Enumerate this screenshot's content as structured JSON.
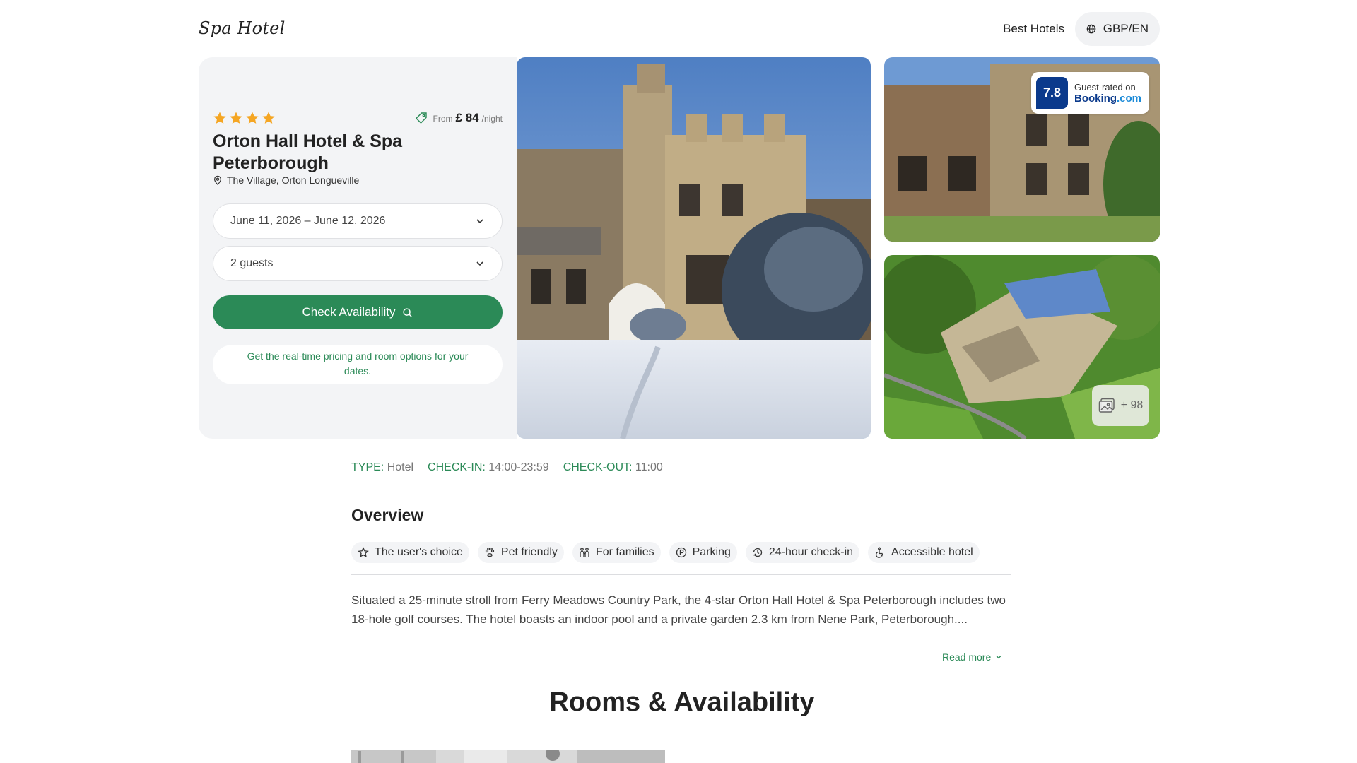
{
  "header": {
    "logo": "Spa Hotel",
    "nav_link": "Best Hotels",
    "currency": "GBP/EN",
    "currency_icon": "globe-icon"
  },
  "hotel": {
    "star_rating": 4,
    "price_prefix": "From",
    "price_amount": "£ 84",
    "price_suffix": "/night",
    "name": "Orton Hall Hotel & Spa Peterborough",
    "address": "The Village, Orton Longueville"
  },
  "booking": {
    "dates": "June 11, 2026 – June 12, 2026",
    "guests": "2 guests",
    "check_button": "Check Availability",
    "hint": "Get the real-time pricing and room options for your dates."
  },
  "rating": {
    "score": "7.8",
    "label": "Guest-rated on",
    "brand_main": "Booking",
    "brand_suffix": ".com"
  },
  "gallery": {
    "more_count": "+ 98"
  },
  "facts": [
    {
      "key": "TYPE:",
      "value": "Hotel"
    },
    {
      "key": "CHECK-IN:",
      "value": "14:00-23:59"
    },
    {
      "key": "CHECK-OUT:",
      "value": "11:00"
    }
  ],
  "overview": {
    "title": "Overview",
    "chips": [
      {
        "label": "The user's choice",
        "icon": "star-outline-icon"
      },
      {
        "label": "Pet friendly",
        "icon": "paw-icon"
      },
      {
        "label": "For families",
        "icon": "family-icon"
      },
      {
        "label": "Parking",
        "icon": "parking-icon"
      },
      {
        "label": "24-hour check-in",
        "icon": "clock-icon"
      },
      {
        "label": "Accessible hotel",
        "icon": "wheelchair-icon"
      }
    ],
    "description": "Situated a 25-minute stroll from Ferry Meadows Country Park, the 4-star Orton Hall Hotel & Spa Peterborough includes two 18-hole golf courses. The hotel boasts an indoor pool and a private garden 2.3 km from Nene Park, Peterborough....",
    "read_more": "Read more"
  },
  "rooms": {
    "title": "Rooms & Availability"
  },
  "colors": {
    "accent_green": "#2b8a57",
    "star_orange": "#f5a623",
    "booking_blue": "#0b3a8c"
  }
}
